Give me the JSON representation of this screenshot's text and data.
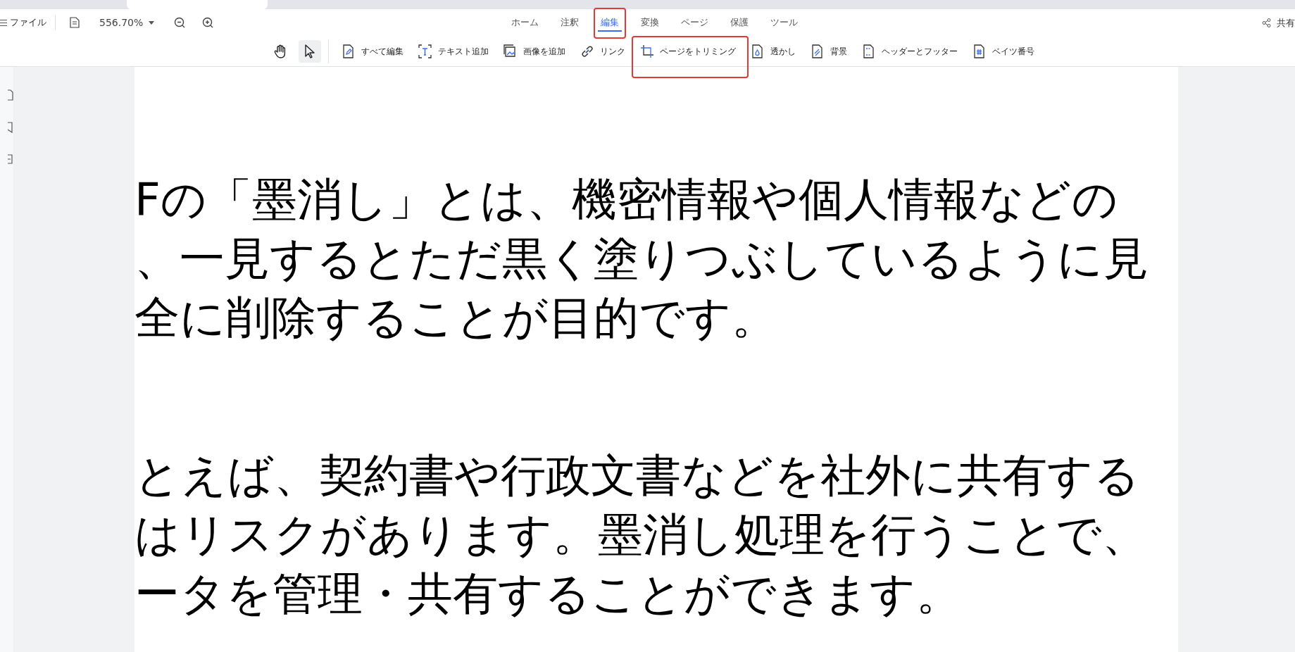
{
  "toolbar": {
    "file_menu": "ファイル",
    "zoom": "556.70%",
    "share": "共有"
  },
  "menu_tabs": [
    {
      "label": "ホーム",
      "selected": false,
      "highlighted": false
    },
    {
      "label": "注釈",
      "selected": false,
      "highlighted": false
    },
    {
      "label": "編集",
      "selected": true,
      "highlighted": true
    },
    {
      "label": "変換",
      "selected": false,
      "highlighted": false
    },
    {
      "label": "ページ",
      "selected": false,
      "highlighted": false
    },
    {
      "label": "保護",
      "selected": false,
      "highlighted": false
    },
    {
      "label": "ツール",
      "selected": false,
      "highlighted": false
    }
  ],
  "mode_tools": [
    {
      "kind": "hand",
      "selected": false
    },
    {
      "kind": "select",
      "selected": true
    }
  ],
  "edit_tools": [
    {
      "kind": "edit-all",
      "label": "すべて編集",
      "highlighted": false
    },
    {
      "kind": "add-text",
      "label": "テキスト追加",
      "highlighted": false
    },
    {
      "kind": "add-image",
      "label": "画像を追加",
      "highlighted": false
    },
    {
      "kind": "link",
      "label": "リンク",
      "highlighted": false
    },
    {
      "kind": "crop",
      "label": "ページをトリミング",
      "highlighted": true
    },
    {
      "kind": "watermark",
      "label": "透かし",
      "highlighted": false
    },
    {
      "kind": "background",
      "label": "背景",
      "highlighted": false
    },
    {
      "kind": "header-footer",
      "label": "ヘッダーとフッター",
      "highlighted": false
    },
    {
      "kind": "bates",
      "label": "ベイツ番号",
      "highlighted": false
    }
  ],
  "document": {
    "paragraphs": [
      [
        "Fの「墨消し」とは、機密情報や個人情報などの",
        "、一見するとただ黒く塗りつぶしているように見",
        "全に削除することが目的です。"
      ],
      [
        "とえば、契約書や行政文書などを社外に共有する",
        "はリスクがあります。墨消し処理を行うことで、",
        "ータを管理・共有することができます。"
      ]
    ]
  }
}
